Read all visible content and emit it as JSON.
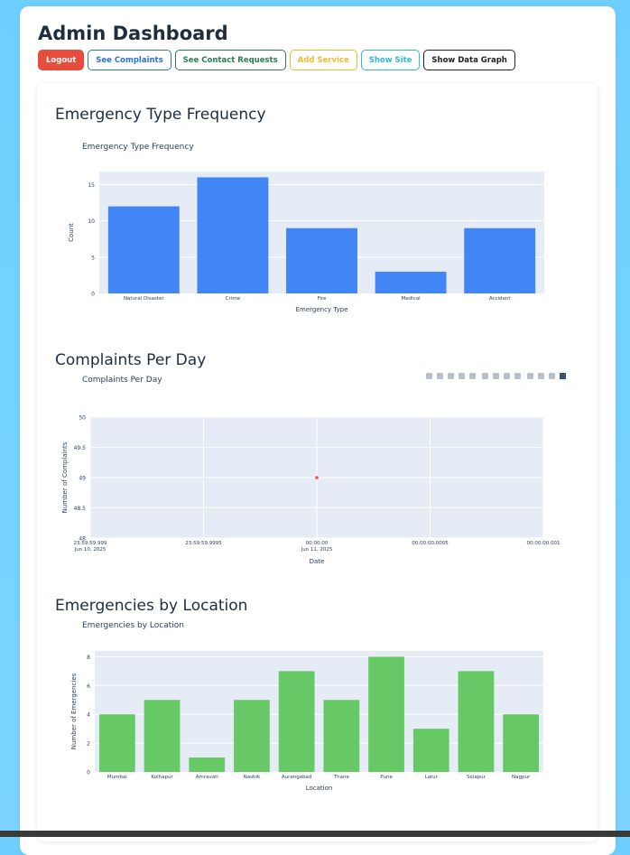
{
  "header": {
    "title": "Admin Dashboard"
  },
  "buttons": {
    "logout": "Logout",
    "see_complaints": "See Complaints",
    "see_contact_requests": "See Contact Requests",
    "add_service": "Add Service",
    "show_site": "Show Site",
    "show_data_graph": "Show Data Graph"
  },
  "sections": {
    "type_frequency": "Emergency Type Frequency",
    "per_day": "Complaints Per Day",
    "by_location": "Emergencies by Location"
  },
  "toolbar_icons": [
    "camera-icon",
    "zoom-icon",
    "pan-icon",
    "box-select-icon",
    "lasso-icon",
    "zoom-in-icon",
    "zoom-out-icon",
    "autoscale-icon",
    "reset-axes-icon",
    "spike-lines-icon",
    "closest-data-icon",
    "compare-data-icon",
    "plotly-logo-icon"
  ],
  "chart_data": [
    {
      "type": "bar",
      "title": "Emergency Type Frequency",
      "xlabel": "Emergency Type",
      "ylabel": "Count",
      "categories": [
        "Natural Disaster",
        "Crime",
        "Fire",
        "Medical",
        "Accident"
      ],
      "values": [
        12,
        16,
        9,
        3,
        9
      ],
      "ylim": [
        0,
        16.8
      ],
      "yticks": [
        0,
        5,
        10,
        15
      ],
      "color": "#4285f4",
      "grid": true
    },
    {
      "type": "scatter",
      "title": "Complaints Per Day",
      "xlabel": "Date",
      "ylabel": "Number of Complaints",
      "x": [
        "2025-06-11 00:00:00"
      ],
      "y": [
        49
      ],
      "ylim": [
        48,
        50
      ],
      "yticks": [
        48,
        48.5,
        49,
        49.5,
        50
      ],
      "xticks": [
        {
          "l1": "23:59:59.999",
          "l2": "Jun 10, 2025"
        },
        {
          "l1": "23:59:59.9995",
          "l2": ""
        },
        {
          "l1": "00:00:00",
          "l2": "Jun 11, 2025"
        },
        {
          "l1": "00:00:00.0005",
          "l2": ""
        },
        {
          "l1": "00:00:00.001",
          "l2": ""
        }
      ],
      "point_index": 2,
      "color": "#ef553b",
      "grid": true
    },
    {
      "type": "bar",
      "title": "Emergencies by Location",
      "xlabel": "Location",
      "ylabel": "Number of Emergencies",
      "categories": [
        "Mumbai",
        "Kolhapur",
        "Amravati",
        "Nashik",
        "Aurangabad",
        "Thane",
        "Pune",
        "Latur",
        "Solapur",
        "Nagpur"
      ],
      "values": [
        4,
        5,
        1,
        5,
        7,
        5,
        8,
        3,
        7,
        4
      ],
      "ylim": [
        0,
        8.4
      ],
      "yticks": [
        0,
        2,
        4,
        6,
        8
      ],
      "color": "#66c966",
      "grid": true
    }
  ]
}
